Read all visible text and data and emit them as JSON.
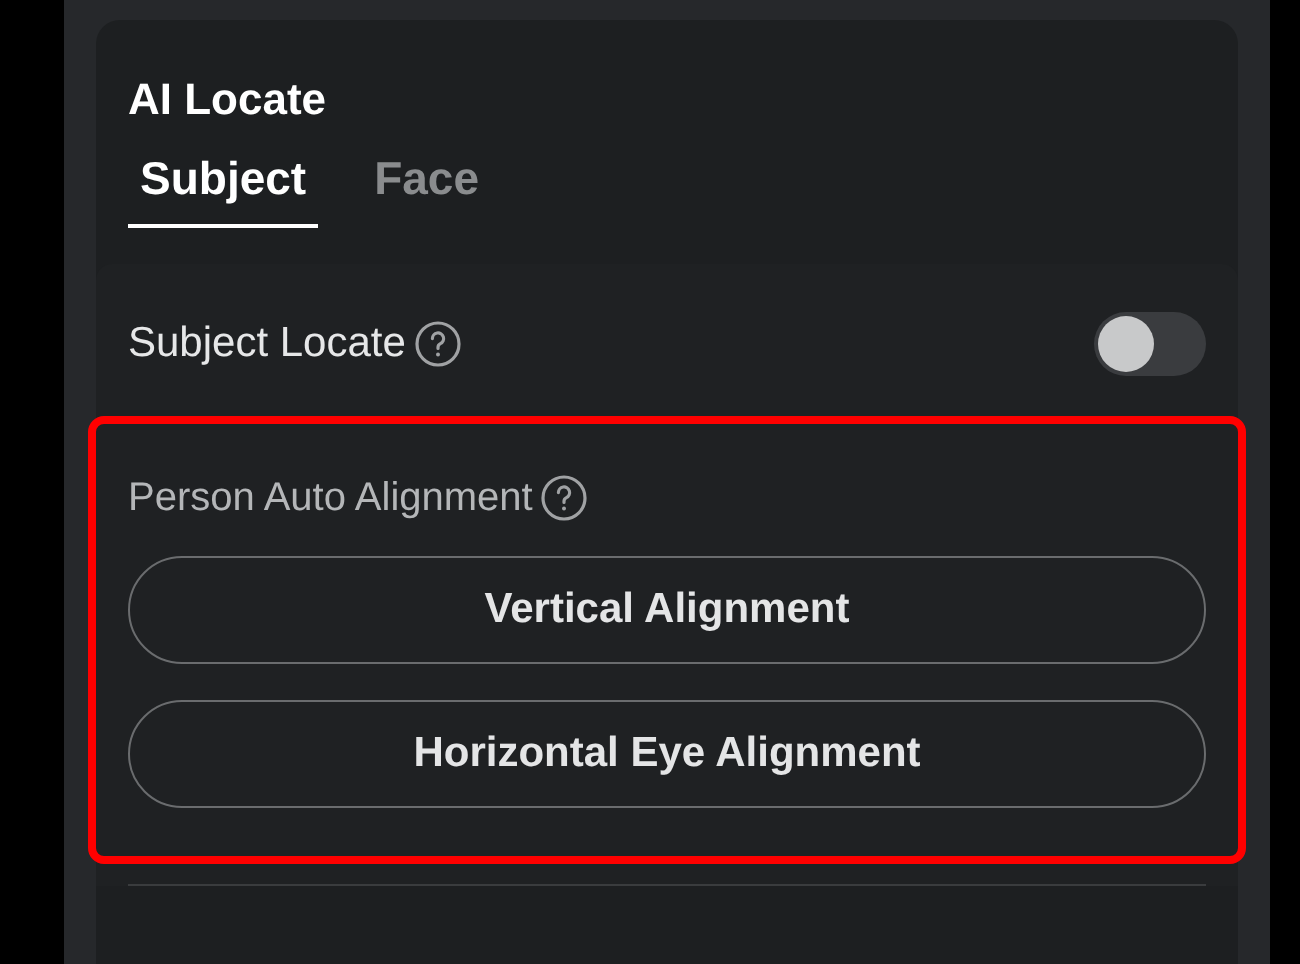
{
  "panel": {
    "title": "AI Locate"
  },
  "tabs": [
    {
      "label": "Subject",
      "selected": true
    },
    {
      "label": "Face",
      "selected": false
    }
  ],
  "subject_locate": {
    "label": "Subject Locate",
    "on": false
  },
  "person_auto_alignment": {
    "label": "Person Auto Alignment",
    "highlighted": true,
    "buttons": [
      "Vertical Alignment",
      "Horizontal Eye Alignment"
    ]
  }
}
